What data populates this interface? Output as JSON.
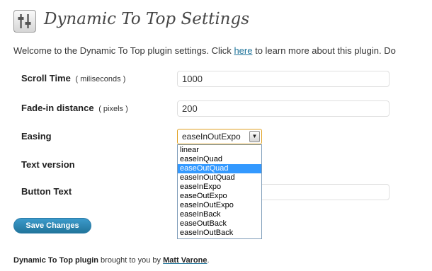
{
  "page": {
    "title": "Dynamic To Top Settings"
  },
  "intro": {
    "text_before": "Welcome to the Dynamic To Top plugin settings. Click ",
    "link": "here",
    "text_after": " to learn more about this plugin. Do"
  },
  "form": {
    "scroll_time": {
      "label": "Scroll Time",
      "unit": "( miliseconds )",
      "value": "1000"
    },
    "fade_distance": {
      "label": "Fade-in distance",
      "unit": "( pixels )",
      "value": "200"
    },
    "easing": {
      "label": "Easing",
      "value": "easeInOutExpo",
      "highlighted": "easeOutQuad",
      "options": [
        "linear",
        "easeInQuad",
        "easeOutQuad",
        "easeInOutQuad",
        "easeInExpo",
        "easeOutExpo",
        "easeInOutExpo",
        "easeInBack",
        "easeOutBack",
        "easeInOutBack"
      ]
    },
    "text_version": {
      "label": "Text version"
    },
    "button_text": {
      "label": "Button Text",
      "value": ""
    },
    "save_label": "Save Changes"
  },
  "footer": {
    "plugin": "Dynamic To Top plugin",
    "middle": " brought to you by ",
    "author": "Matt Varone",
    "end": "."
  },
  "colors": {
    "link": "#21759b",
    "button": "#21759b",
    "highlight": "#3399ff"
  },
  "icons": [
    "settings-sliders-icon",
    "dropdown-arrow-icon"
  ]
}
